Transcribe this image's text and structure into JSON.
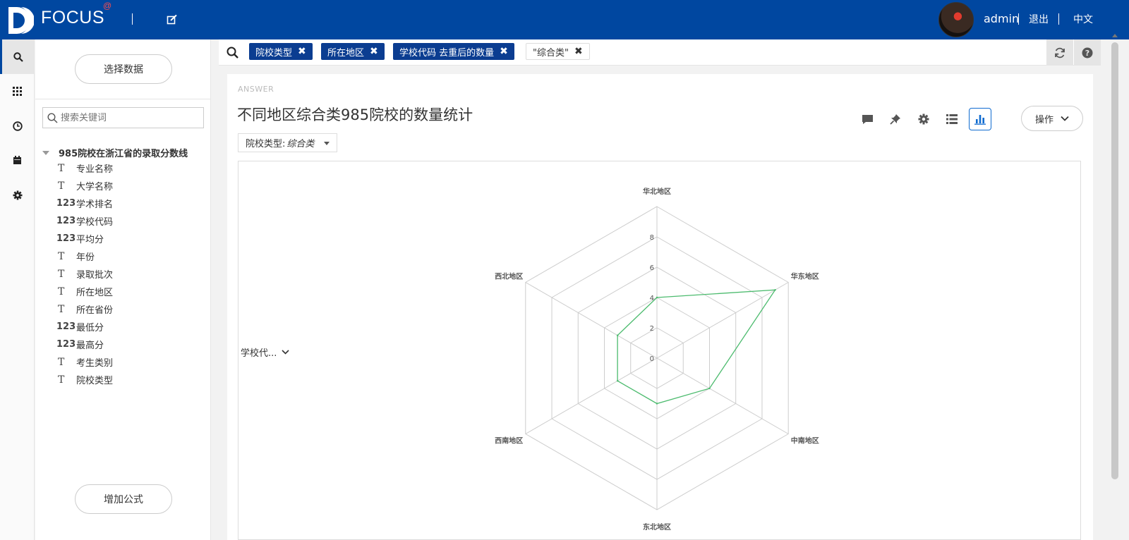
{
  "topbar": {
    "brand": "FOCUS",
    "brand_mark": "@",
    "user": "admin",
    "logout": "退出",
    "language": "中文"
  },
  "leftnav": {
    "items": [
      "search-icon",
      "grid-icon",
      "history-icon",
      "calendar-icon",
      "gear-icon"
    ],
    "active": "search-icon"
  },
  "panel": {
    "select_data": "选择数据",
    "search_placeholder": "搜索关键词",
    "dataset": "985院校在浙江省的录取分数线",
    "fields": [
      {
        "type": "T",
        "name": "专业名称"
      },
      {
        "type": "T",
        "name": "大学名称"
      },
      {
        "type": "123",
        "name": "学术排名"
      },
      {
        "type": "123",
        "name": "学校代码"
      },
      {
        "type": "123",
        "name": "平均分"
      },
      {
        "type": "T",
        "name": "年份"
      },
      {
        "type": "T",
        "name": "录取批次"
      },
      {
        "type": "T",
        "name": "所在地区"
      },
      {
        "type": "T",
        "name": "所在省份"
      },
      {
        "type": "123",
        "name": "最低分"
      },
      {
        "type": "123",
        "name": "最高分"
      },
      {
        "type": "T",
        "name": "考生类别"
      },
      {
        "type": "T",
        "name": "院校类型"
      }
    ],
    "add_formula": "增加公式"
  },
  "searchbar": {
    "tags": [
      {
        "label": "院校类型",
        "style": "filled"
      },
      {
        "label": "所在地区",
        "style": "filled"
      },
      {
        "label": "学校代码 去重后的数量",
        "style": "filled"
      },
      {
        "label": "\"综合类\"",
        "style": "plain"
      }
    ]
  },
  "answer": {
    "label": "ANSWER",
    "title": "不同地区综合类985院校的数量统计",
    "filter_label": "院校类型:",
    "filter_value": "综合类",
    "ops_label": "操作",
    "axis_field": "学校代...",
    "toolbar_icons": [
      "comment-icon",
      "pin-icon",
      "settings-icon",
      "list-icon",
      "bar-chart-icon"
    ],
    "active_view": "bar-chart-icon"
  },
  "chart_data": {
    "type": "radar",
    "categories": [
      "华北地区",
      "华东地区",
      "中南地区",
      "东北地区",
      "西南地区",
      "西北地区"
    ],
    "series": [
      {
        "values": [
          4,
          9,
          4,
          3,
          3,
          3
        ],
        "color": "#4cbb6e"
      }
    ],
    "ticks": [
      0,
      2,
      4,
      6,
      8
    ],
    "range": [
      0,
      10
    ],
    "grid_color": "#cccccc"
  }
}
